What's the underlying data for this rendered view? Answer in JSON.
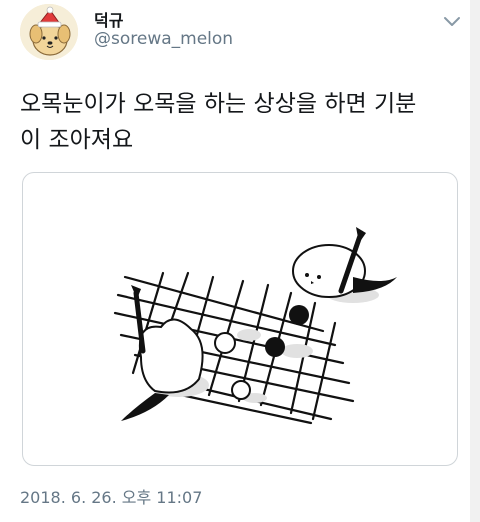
{
  "user": {
    "display_name": "덕규",
    "handle": "@sorewa_melon",
    "avatar_icon": "cartoon-dog-avatar-icon"
  },
  "tweet": {
    "text_line1": "오목눈이가 오목을 하는 상상을 하면 기분",
    "text_line2": "이 조아져요",
    "timestamp": "2018. 6. 26. 오후 11:07"
  },
  "media": {
    "description_icon": "illustration-birds-playing-omok"
  },
  "colors": {
    "handle_gray": "#657786",
    "text": "#14171a",
    "border": "#d0d5d9"
  }
}
